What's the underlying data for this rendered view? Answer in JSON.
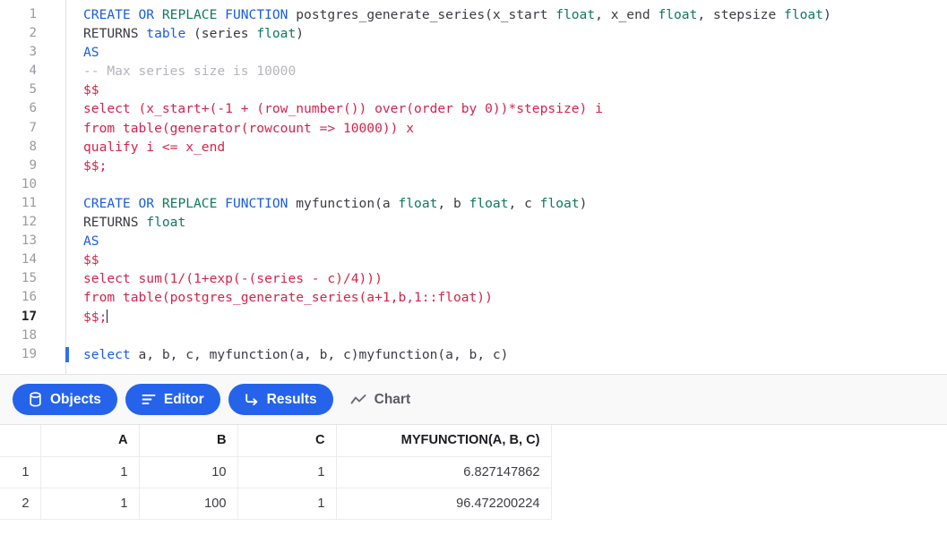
{
  "editor": {
    "cursor_line": 17,
    "marker_line": 19,
    "colors": {
      "keyword": "#1a5ce0",
      "keyword_alt": "#0d7a5f",
      "type": "#0d7a5f",
      "string_body": "#d6234c",
      "comment": "#b4b4bb",
      "text": "#3b3b42",
      "gutter": "#9a9aa2",
      "cursor_marker": "#2f6fed"
    },
    "lines": [
      {
        "n": "1",
        "tokens": [
          {
            "t": "CREATE OR ",
            "c": "kw"
          },
          {
            "t": "REPLACE ",
            "c": "kw2"
          },
          {
            "t": "FUNCTION ",
            "c": "kw"
          },
          {
            "t": "postgres_generate_series(x_start ",
            "c": "txt"
          },
          {
            "t": "float",
            "c": "type"
          },
          {
            "t": ", x_end ",
            "c": "txt"
          },
          {
            "t": "float",
            "c": "type"
          },
          {
            "t": ", stepsize ",
            "c": "txt"
          },
          {
            "t": "float",
            "c": "type"
          },
          {
            "t": ")",
            "c": "txt"
          }
        ]
      },
      {
        "n": "2",
        "tokens": [
          {
            "t": " RETURNS ",
            "c": "txt"
          },
          {
            "t": "table ",
            "c": "kw"
          },
          {
            "t": "(series ",
            "c": "txt"
          },
          {
            "t": "float",
            "c": "type"
          },
          {
            "t": ")",
            "c": "txt"
          }
        ]
      },
      {
        "n": "3",
        "tokens": [
          {
            "t": "AS",
            "c": "kw"
          }
        ]
      },
      {
        "n": "4",
        "tokens": [
          {
            "t": "-- Max series size is 10000",
            "c": "cmt"
          }
        ]
      },
      {
        "n": "5",
        "tokens": [
          {
            "t": "$$",
            "c": "str"
          }
        ]
      },
      {
        "n": "6",
        "tokens": [
          {
            "t": "select (x_start+(-1 + (row_number()) over(order by 0))*stepsize) i",
            "c": "str"
          }
        ]
      },
      {
        "n": "7",
        "tokens": [
          {
            "t": "from table(generator(rowcount => 10000)) x",
            "c": "str"
          }
        ]
      },
      {
        "n": "8",
        "tokens": [
          {
            "t": "qualify i <= x_end",
            "c": "str"
          }
        ]
      },
      {
        "n": "9",
        "tokens": [
          {
            "t": "$$;",
            "c": "str"
          }
        ]
      },
      {
        "n": "10",
        "tokens": []
      },
      {
        "n": "11",
        "tokens": [
          {
            "t": "CREATE OR ",
            "c": "kw"
          },
          {
            "t": "REPLACE ",
            "c": "kw2"
          },
          {
            "t": "FUNCTION ",
            "c": "kw"
          },
          {
            "t": "myfunction(a ",
            "c": "txt"
          },
          {
            "t": "float",
            "c": "type"
          },
          {
            "t": ", b ",
            "c": "txt"
          },
          {
            "t": "float",
            "c": "type"
          },
          {
            "t": ", c ",
            "c": "txt"
          },
          {
            "t": "float",
            "c": "type"
          },
          {
            "t": ")",
            "c": "txt"
          }
        ]
      },
      {
        "n": "12",
        "tokens": [
          {
            "t": " RETURNS ",
            "c": "txt"
          },
          {
            "t": "float",
            "c": "type"
          }
        ]
      },
      {
        "n": "13",
        "tokens": [
          {
            "t": "AS",
            "c": "kw"
          }
        ]
      },
      {
        "n": "14",
        "tokens": [
          {
            "t": "$$",
            "c": "str"
          }
        ]
      },
      {
        "n": "15",
        "tokens": [
          {
            "t": "select sum(1/(1+exp(-(series - c)/4)))",
            "c": "str"
          }
        ]
      },
      {
        "n": "16",
        "tokens": [
          {
            "t": "from table(postgres_generate_series(a+1,b,1::float))",
            "c": "str"
          }
        ]
      },
      {
        "n": "17",
        "tokens": [
          {
            "t": "$$;",
            "c": "str"
          }
        ]
      },
      {
        "n": "18",
        "tokens": []
      },
      {
        "n": "19",
        "tokens": [
          {
            "t": "select    a,   b,   c,   ",
            "c": "kw_mixed_select"
          },
          {
            "t": "myfunction(a, b, c)",
            "c": "txt"
          }
        ]
      }
    ],
    "line19": {
      "keyword": "select",
      "rest": "    a,   b,   c,   myfunction(a, b, c)"
    }
  },
  "tabs": [
    {
      "label": "Objects",
      "icon": "database-icon",
      "active": true
    },
    {
      "label": "Editor",
      "icon": "list-lines-icon",
      "active": true
    },
    {
      "label": "Results",
      "icon": "arrow-return-icon",
      "active": true
    },
    {
      "label": "Chart",
      "icon": "line-chart-icon",
      "active": false
    }
  ],
  "results": {
    "columns": [
      "",
      "A",
      "B",
      "C",
      "MYFUNCTION(A, B, C)"
    ],
    "rows": [
      {
        "num": "1",
        "cells": [
          "1",
          "10",
          "1",
          "6.827147862"
        ]
      },
      {
        "num": "2",
        "cells": [
          "1",
          "100",
          "1",
          "96.472200224"
        ]
      }
    ]
  }
}
